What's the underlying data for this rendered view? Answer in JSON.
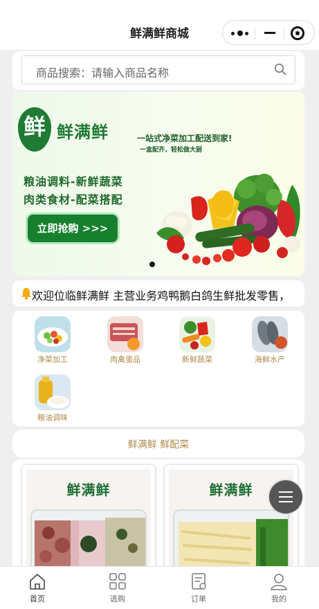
{
  "navbar": {
    "title": "鲜满鲜商城"
  },
  "search": {
    "placeholder": "商品搜索：请输入商品名称"
  },
  "banner": {
    "logo_glyph": "鲜",
    "brand": "鲜满鲜",
    "slogan": "一站式净菜加工配送到家!",
    "subslogan": "一盒配齐，轻松做大厨",
    "category_line1": "粮油调料-新鲜蔬菜",
    "category_line2": "肉类食材-配菜搭配",
    "button": "立即抢购 >>>"
  },
  "notice": {
    "text": "欢迎位临鲜满鲜 主营业务鸡鸭鹅白鸽生鲜批发零售，"
  },
  "categories": [
    {
      "label": "净菜加工",
      "icon": "prepped-veg-icon"
    },
    {
      "label": "肉禽蛋品",
      "icon": "meat-icon"
    },
    {
      "label": "新鲜蔬菜",
      "icon": "vegetables-icon"
    },
    {
      "label": "海鲜水产",
      "icon": "seafood-icon"
    },
    {
      "label": "粮油调味",
      "icon": "oil-rice-icon"
    }
  ],
  "section": {
    "title": "鲜满鲜 鲜配菜"
  },
  "products": [
    {
      "brand": "鲜满鲜"
    },
    {
      "brand": "鲜满鲜"
    }
  ],
  "tabbar": [
    {
      "label": "首页",
      "icon": "home-icon",
      "active": true
    },
    {
      "label": "选购",
      "icon": "grid-icon",
      "active": false
    },
    {
      "label": "订单",
      "icon": "order-icon",
      "active": false
    },
    {
      "label": "我的",
      "icon": "user-icon",
      "active": false
    }
  ]
}
